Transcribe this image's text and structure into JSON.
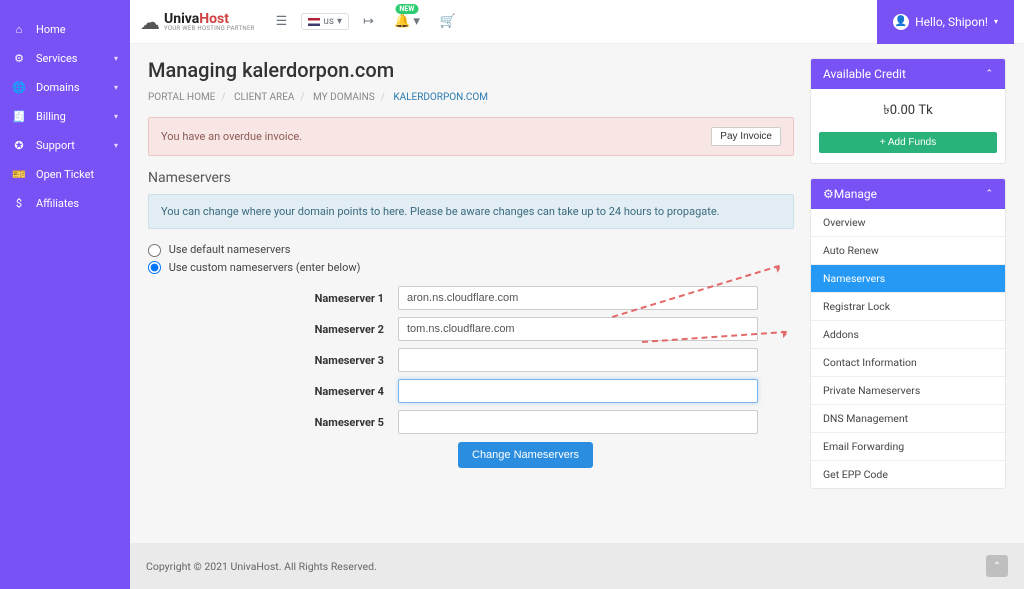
{
  "logo": {
    "part1": "Univa",
    "part2": "Host",
    "tagline": "YOUR WEB HOSTING PARTNER"
  },
  "topbar": {
    "lang": "us",
    "newBadge": "NEW"
  },
  "user": {
    "greeting": "Hello, Shipon!"
  },
  "sidebar": {
    "items": [
      {
        "label": "Home",
        "icon": "ic-home",
        "caret": false
      },
      {
        "label": "Services",
        "icon": "ic-gear",
        "caret": true
      },
      {
        "label": "Domains",
        "icon": "ic-globe",
        "caret": true
      },
      {
        "label": "Billing",
        "icon": "ic-bill",
        "caret": true
      },
      {
        "label": "Support",
        "icon": "ic-life",
        "caret": true
      },
      {
        "label": "Open Ticket",
        "icon": "ic-ticket",
        "caret": false
      },
      {
        "label": "Affiliates",
        "icon": "ic-dollar",
        "caret": false
      }
    ]
  },
  "page": {
    "title": "Managing kalerdorpon.com"
  },
  "breadcrumb": {
    "items": [
      "PORTAL HOME",
      "CLIENT AREA",
      "MY DOMAINS",
      "KALERDORPON.COM"
    ]
  },
  "alert": {
    "text": "You have an overdue invoice.",
    "button": "Pay Invoice"
  },
  "ns": {
    "sectionTitle": "Nameservers",
    "info": "You can change where your domain points to here. Please be aware changes can take up to 24 hours to propagate.",
    "radioDefault": "Use default nameservers",
    "radioCustom": "Use custom nameservers (enter below)",
    "labels": [
      "Nameserver 1",
      "Nameserver 2",
      "Nameserver 3",
      "Nameserver 4",
      "Nameserver 5"
    ],
    "values": [
      "aron.ns.cloudflare.com",
      "tom.ns.cloudflare.com",
      "",
      "",
      ""
    ],
    "submit": "Change Nameservers"
  },
  "credit": {
    "title": "Available Credit",
    "amount": "৳0.00 Tk",
    "addFunds": "+ Add Funds"
  },
  "manage": {
    "title": "Manage",
    "items": [
      "Overview",
      "Auto Renew",
      "Nameservers",
      "Registrar Lock",
      "Addons",
      "Contact Information",
      "Private Nameservers",
      "DNS Management",
      "Email Forwarding",
      "Get EPP Code"
    ],
    "activeIndex": 2
  },
  "footer": {
    "text": "Copyright © 2021 UnivaHost. All Rights Reserved."
  }
}
